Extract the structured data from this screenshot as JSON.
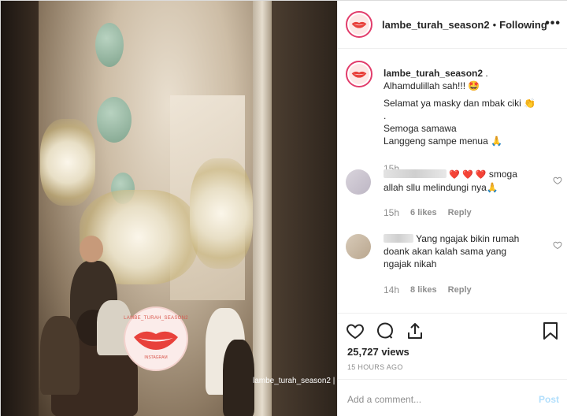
{
  "video": {
    "watermark_top": "LAMBE_TURAH_SEASON2",
    "watermark_bottom": "INSTAGRAM",
    "caption_watermark": "lambe_turah_season2 |"
  },
  "header": {
    "username": "lambe_turah_season2",
    "separator": "•",
    "follow_label": "Following",
    "more_label": "•••"
  },
  "post": {
    "username": "lambe_turah_season2",
    "username_suffix": " .",
    "lines": [
      "Alhamdulillah sah!!! 🤩",
      "Selamat ya masky dan mbak ciki 👏",
      ".",
      "Semoga samawa",
      "Langgeng sampe menua 🙏"
    ],
    "time": "15h"
  },
  "comments": [
    {
      "text": "smoga allah sllu melindungi nya🙏",
      "hearts": "❤️ ❤️ ❤️",
      "time": "15h",
      "likes": "6 likes",
      "reply": "Reply"
    },
    {
      "text": "Yang ngajak bikin rumah doank akan kalah sama yang ngajak nikah",
      "time": "14h",
      "likes": "8 likes",
      "reply": "Reply"
    }
  ],
  "stats": {
    "views": "25,727 views",
    "ago": "15 HOURS AGO"
  },
  "compose": {
    "placeholder": "Add a comment...",
    "post_label": "Post"
  },
  "colors": {
    "accent_link": "#b2dffc",
    "heart": "#e0245e",
    "avatar_ring": "#e23d6b"
  }
}
